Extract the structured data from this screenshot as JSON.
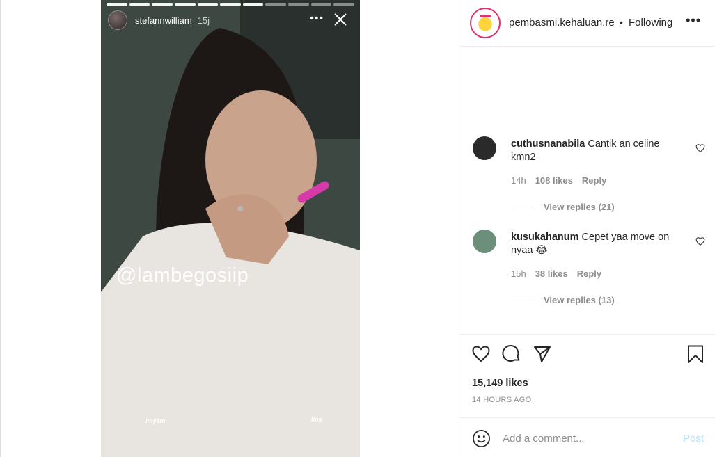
{
  "story": {
    "username": "stefannwilliam",
    "time": "15j",
    "more_label": "•••",
    "overlay_tag": "@lambegosiip",
    "sticker_left": "imysm",
    "sticker_right": "lips",
    "progress_segments": 11,
    "progress_done": 7
  },
  "post": {
    "author": "pembasmi.kehaluan.re",
    "separator": "•",
    "follow_status": "Following",
    "more_label": "•••",
    "likes": "15,149 likes",
    "time_ago": "14 HOURS AGO"
  },
  "comments": [
    {
      "user": "cuthusnanabila",
      "text": "Cantik an celine kmn2",
      "time": "14h",
      "likes": "108 likes",
      "reply": "Reply",
      "view_replies": "View replies (21)",
      "avatar_color": "#2a2a2a"
    },
    {
      "user": "kusukahanum",
      "text": "Cepet yaa move on nyaa 😂",
      "time": "15h",
      "likes": "38 likes",
      "reply": "Reply",
      "view_replies": "View replies (13)",
      "avatar_color": "#6b8f7a"
    }
  ],
  "add_comment": {
    "placeholder": "Add a comment...",
    "post_label": "Post"
  },
  "icons": {
    "like": "heart-icon",
    "comment": "comment-icon",
    "share": "share-icon",
    "save": "bookmark-icon",
    "emoji": "emoji-icon",
    "close": "close-icon"
  },
  "colors": {
    "post_button_disabled": "#b2dffc",
    "secondary_text": "#8e8e8e",
    "avatar_ring": "#e1306c"
  }
}
